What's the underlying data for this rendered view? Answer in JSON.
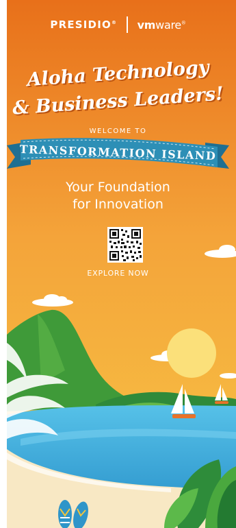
{
  "logos": {
    "presidio": "PRESIDIO",
    "presidio_mark": "®",
    "vmware_bold": "vm",
    "vmware_rest": "ware",
    "vmware_mark": "®"
  },
  "headline": {
    "line1": "Aloha Technology",
    "line2": "& Business Leaders!"
  },
  "welcome": "WELCOME TO",
  "ribbon": "TRANSFORMATION ISLAND",
  "tagline": {
    "line1": "Your Foundation",
    "line2": "for Innovation"
  },
  "qr_code": {
    "icon": "qr-code-icon"
  },
  "cta": "EXPLORE NOW",
  "colors": {
    "sky_top": "#e9731b",
    "sky_bottom": "#f6bf3c",
    "ribbon": "#2d8fb6",
    "sea": "#3bb1e2",
    "sand": "#f8e8c4",
    "island": "#4fa33b",
    "sun": "#fbe07a"
  }
}
